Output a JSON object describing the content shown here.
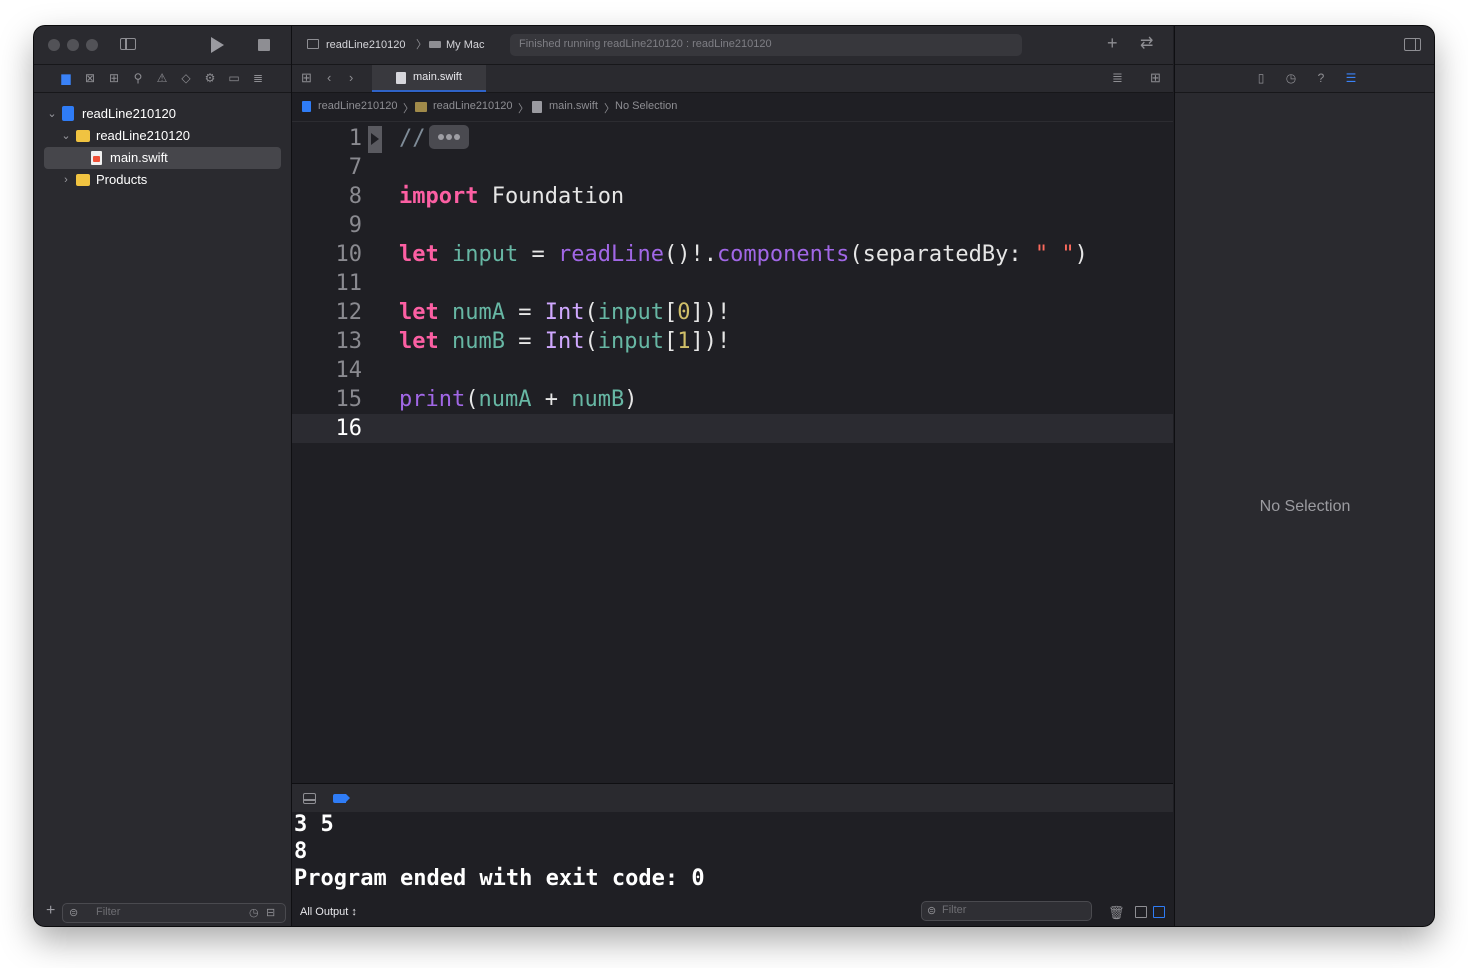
{
  "toolbar": {
    "scheme": "readLine210120",
    "destination": "My Mac",
    "activity_status": "Finished running readLine210120 : readLine210120"
  },
  "navigator": {
    "tree": [
      {
        "label": "readLine210120",
        "icon": "project-icon",
        "disclosure": "expanded"
      },
      {
        "label": "readLine210120",
        "icon": "folder-icon",
        "disclosure": "expanded"
      },
      {
        "label": "main.swift",
        "icon": "swift-file-icon",
        "selected": true
      },
      {
        "label": "Products",
        "icon": "folder-icon",
        "disclosure": "collapsed"
      }
    ],
    "filter_placeholder": "Filter"
  },
  "editor": {
    "tab_label": "main.swift",
    "breadcrumbs": [
      "readLine210120",
      "readLine210120",
      "main.swift",
      "No Selection"
    ],
    "lines": [
      {
        "number": "1",
        "folded": true,
        "tokens": [
          {
            "t": "//",
            "c": "cm"
          }
        ]
      },
      {
        "number": "7",
        "tokens": []
      },
      {
        "number": "8",
        "tokens": [
          {
            "t": "import",
            "c": "kw"
          },
          {
            "t": " Foundation",
            "c": "pl"
          }
        ]
      },
      {
        "number": "9",
        "tokens": []
      },
      {
        "number": "10",
        "tokens": [
          {
            "t": "let",
            "c": "kw"
          },
          {
            "t": " ",
            "c": "pl"
          },
          {
            "t": "input",
            "c": "va"
          },
          {
            "t": " = ",
            "c": "pl"
          },
          {
            "t": "readLine",
            "c": "fn"
          },
          {
            "t": "()!.",
            "c": "pl"
          },
          {
            "t": "components",
            "c": "fn"
          },
          {
            "t": "(separatedBy: ",
            "c": "pl"
          },
          {
            "t": "\" \"",
            "c": "st"
          },
          {
            "t": ")",
            "c": "pl"
          }
        ]
      },
      {
        "number": "11",
        "tokens": []
      },
      {
        "number": "12",
        "tokens": [
          {
            "t": "let",
            "c": "kw"
          },
          {
            "t": " ",
            "c": "pl"
          },
          {
            "t": "numA",
            "c": "va"
          },
          {
            "t": " = ",
            "c": "pl"
          },
          {
            "t": "Int",
            "c": "ty"
          },
          {
            "t": "(",
            "c": "pl"
          },
          {
            "t": "input",
            "c": "va"
          },
          {
            "t": "[",
            "c": "pl"
          },
          {
            "t": "0",
            "c": "nu"
          },
          {
            "t": "])!",
            "c": "pl"
          }
        ]
      },
      {
        "number": "13",
        "tokens": [
          {
            "t": "let",
            "c": "kw"
          },
          {
            "t": " ",
            "c": "pl"
          },
          {
            "t": "numB",
            "c": "va"
          },
          {
            "t": " = ",
            "c": "pl"
          },
          {
            "t": "Int",
            "c": "ty"
          },
          {
            "t": "(",
            "c": "pl"
          },
          {
            "t": "input",
            "c": "va"
          },
          {
            "t": "[",
            "c": "pl"
          },
          {
            "t": "1",
            "c": "nu"
          },
          {
            "t": "])!",
            "c": "pl"
          }
        ]
      },
      {
        "number": "14",
        "tokens": []
      },
      {
        "number": "15",
        "tokens": [
          {
            "t": "print",
            "c": "fn"
          },
          {
            "t": "(",
            "c": "pl"
          },
          {
            "t": "numA",
            "c": "va"
          },
          {
            "t": " + ",
            "c": "pl"
          },
          {
            "t": "numB",
            "c": "va"
          },
          {
            "t": ")",
            "c": "pl"
          }
        ]
      },
      {
        "number": "16",
        "current": true,
        "tokens": []
      }
    ]
  },
  "console": {
    "lines": [
      "3 5",
      "8",
      "Program ended with exit code: 0"
    ],
    "output_selector": "All Output ↕",
    "filter_placeholder": "Filter"
  },
  "inspector": {
    "empty_message": "No Selection"
  },
  "colors": {
    "keyword": "#fc5fa3",
    "type": "#d0a8ff",
    "variable": "#67b7a4",
    "function": "#a167e6",
    "string": "#fc6a5d",
    "number": "#d0bf69",
    "accent": "#2f63c8"
  }
}
